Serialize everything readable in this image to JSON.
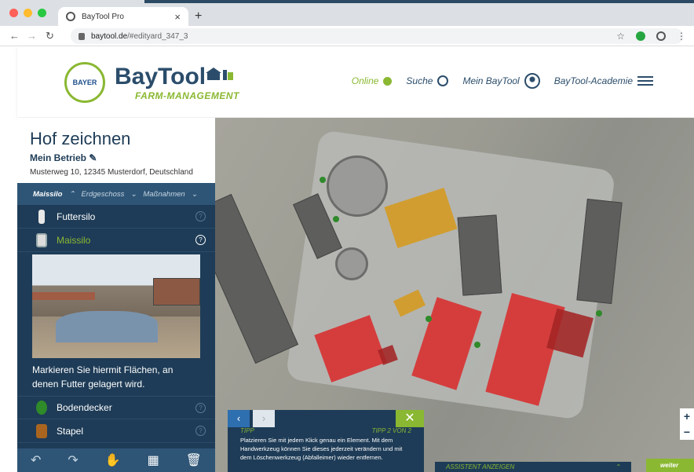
{
  "browser": {
    "tab_title": "BayTool Pro",
    "tab_close": "×",
    "new_tab": "+",
    "url_host": "baytool.de",
    "url_path": "/#edityard_347_3"
  },
  "header": {
    "bayer_text": "BAYER",
    "bayer_vertical": "B A Y E R",
    "brand": "BayTool",
    "brand_sub": "FARM-MANAGEMENT",
    "online_label": "Online",
    "search_label": "Suche",
    "account_label": "Mein BayTool",
    "academy_label": "BayTool-Academie"
  },
  "sidebar": {
    "title": "Hof zeichnen",
    "farm_name": "Mein Betrieb",
    "farm_address": "Musterweg 10, 12345 Musterdorf, Deutschland",
    "filter": {
      "item1": "Maissilo",
      "item2": "Erdgeschoss",
      "item3": "Maßnahmen"
    },
    "items": [
      {
        "label": "Futtersilo"
      },
      {
        "label": "Maissilo"
      },
      {
        "label": "Bodendecker"
      },
      {
        "label": "Stapel"
      }
    ],
    "description": "Markieren Sie hiermit Flächen, an denen Futter gelagert wird."
  },
  "tip": {
    "label": "TIPP",
    "counter": "TIPP 2 VON 2",
    "text": "Platzieren Sie mit jedem Klick genau ein Element. Mit dem Handwerkzeug können Sie dieses jederzeit verändern und mit dem Löschenwerkzeug (Abfalleimer) wieder entfernen."
  },
  "assistant_label": "ASSISTENT ANZEIGEN",
  "next_label": "weiter",
  "zoom": {
    "in": "+",
    "out": "−"
  },
  "colors": {
    "navy": "#1e3c57",
    "green": "#8ab832",
    "building_red": "#d92c2c",
    "feed_orange": "#d49a22"
  }
}
